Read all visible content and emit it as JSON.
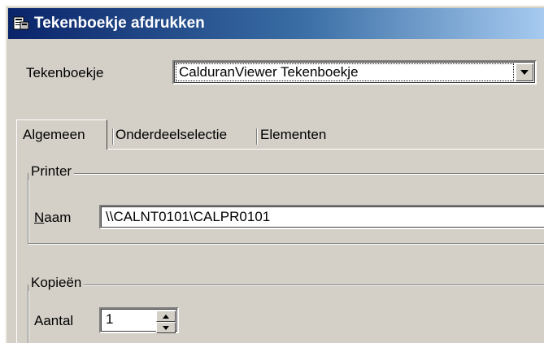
{
  "window": {
    "title": "Tekenboekje afdrukken",
    "icon": "print-book-icon"
  },
  "tekenboekje": {
    "label": "Tekenboekje",
    "selected": "CalduranViewer Tekenboekje"
  },
  "tabs": [
    {
      "label": "Algemeen",
      "active": true
    },
    {
      "label": "Onderdeelselectie",
      "active": false
    },
    {
      "label": "Elementen",
      "active": false
    }
  ],
  "printer": {
    "group_label": "Printer",
    "name_label_mnemonic": "N",
    "name_label_rest": "aam",
    "name_value": "\\\\CALNT0101\\CALPR0101"
  },
  "copies": {
    "group_label": "Kopieën",
    "count_label": "Aantal",
    "count_value": "1"
  }
}
